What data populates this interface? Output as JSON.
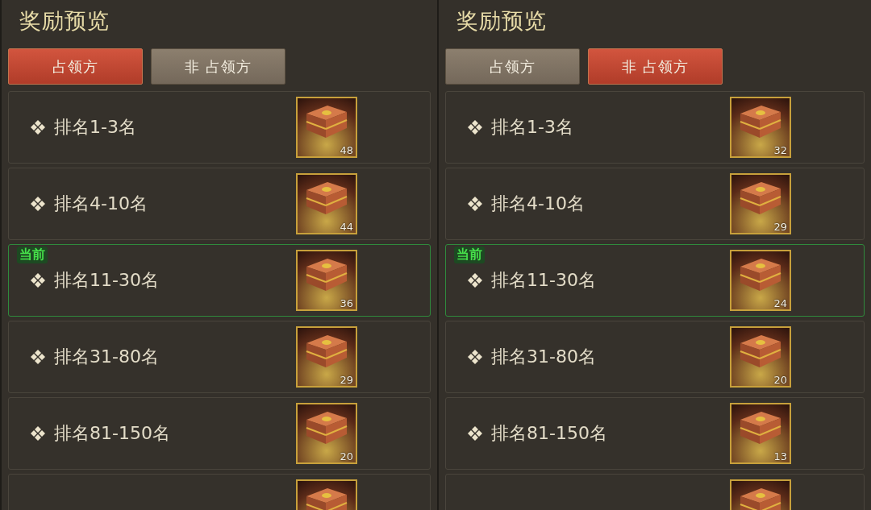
{
  "panels": [
    {
      "title": "奖励预览",
      "tabs": [
        {
          "label": "占领方",
          "selected": true
        },
        {
          "label": "非 占领方",
          "selected": false
        }
      ],
      "rows": [
        {
          "label": "排名1-3名",
          "count": "48",
          "current": false
        },
        {
          "label": "排名4-10名",
          "count": "44",
          "current": false
        },
        {
          "label": "排名11-30名",
          "count": "36",
          "current": true,
          "badge": "当前"
        },
        {
          "label": "排名31-80名",
          "count": "29",
          "current": false
        },
        {
          "label": "排名81-150名",
          "count": "20",
          "current": false
        },
        {
          "current": false
        }
      ]
    },
    {
      "title": "奖励预览",
      "tabs": [
        {
          "label": "占领方",
          "selected": false
        },
        {
          "label": "非 占领方",
          "selected": true
        }
      ],
      "rows": [
        {
          "label": "排名1-3名",
          "count": "32",
          "current": false
        },
        {
          "label": "排名4-10名",
          "count": "29",
          "current": false
        },
        {
          "label": "排名11-30名",
          "count": "24",
          "current": true,
          "badge": "当前"
        },
        {
          "label": "排名31-80名",
          "count": "20",
          "current": false
        },
        {
          "label": "排名81-150名",
          "count": "13",
          "current": false
        },
        {
          "current": false
        }
      ]
    }
  ]
}
